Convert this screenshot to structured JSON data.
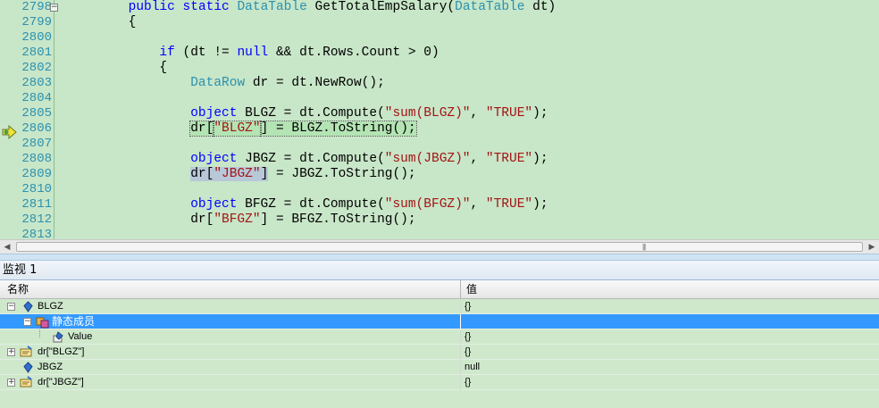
{
  "editor": {
    "line_numbers": [
      "2798",
      "2799",
      "2800",
      "2801",
      "2802",
      "2803",
      "2804",
      "2805",
      "2806",
      "2807",
      "2808",
      "2809",
      "2810",
      "2811",
      "2812",
      "2813"
    ],
    "lines": [
      [
        {
          "t": "        ",
          "c": ""
        },
        {
          "t": "public",
          "c": "kw"
        },
        {
          "t": " ",
          "c": ""
        },
        {
          "t": "static",
          "c": "kw"
        },
        {
          "t": " ",
          "c": ""
        },
        {
          "t": "DataTable",
          "c": "ty"
        },
        {
          "t": " GetTotalEmpSalary(",
          "c": ""
        },
        {
          "t": "DataTable",
          "c": "ty"
        },
        {
          "t": " dt)",
          "c": ""
        }
      ],
      [
        {
          "t": "        {",
          "c": ""
        }
      ],
      [],
      [
        {
          "t": "            ",
          "c": ""
        },
        {
          "t": "if",
          "c": "kw"
        },
        {
          "t": " (dt != ",
          "c": ""
        },
        {
          "t": "null",
          "c": "kw"
        },
        {
          "t": " && dt.Rows.Count > 0)",
          "c": ""
        }
      ],
      [
        {
          "t": "            {",
          "c": ""
        }
      ],
      [
        {
          "t": "                ",
          "c": ""
        },
        {
          "t": "DataRow",
          "c": "ty"
        },
        {
          "t": " dr = dt.NewRow();",
          "c": ""
        }
      ],
      [],
      [
        {
          "t": "                ",
          "c": ""
        },
        {
          "t": "object",
          "c": "kw"
        },
        {
          "t": " BLGZ = dt.Compute(",
          "c": ""
        },
        {
          "t": "\"sum(BLGZ)\"",
          "c": "st"
        },
        {
          "t": ", ",
          "c": ""
        },
        {
          "t": "\"TRUE\"",
          "c": "st"
        },
        {
          "t": ");",
          "c": ""
        }
      ],
      [
        {
          "t": "                ",
          "c": ""
        },
        {
          "t": "dr[",
          "c": "cur-stmt"
        },
        {
          "t": "\"BLGZ\"",
          "c": "cur-stmt st"
        },
        {
          "t": "] = BLGZ.ToString();",
          "c": "cur-stmt"
        }
      ],
      [],
      [
        {
          "t": "                ",
          "c": ""
        },
        {
          "t": "object",
          "c": "kw"
        },
        {
          "t": " JBGZ = dt.Compute(",
          "c": ""
        },
        {
          "t": "\"sum(JBGZ)\"",
          "c": "st"
        },
        {
          "t": ", ",
          "c": ""
        },
        {
          "t": "\"TRUE\"",
          "c": "st"
        },
        {
          "t": ");",
          "c": ""
        }
      ],
      [
        {
          "t": "                ",
          "c": ""
        },
        {
          "t": "dr[",
          "c": "sel-token"
        },
        {
          "t": "\"JBGZ\"",
          "c": "sel-token st"
        },
        {
          "t": "]",
          "c": "sel-token"
        },
        {
          "t": " = JBGZ.ToString();",
          "c": ""
        }
      ],
      [],
      [
        {
          "t": "                ",
          "c": ""
        },
        {
          "t": "object",
          "c": "kw"
        },
        {
          "t": " BFGZ = dt.Compute(",
          "c": ""
        },
        {
          "t": "\"sum(BFGZ)\"",
          "c": "st"
        },
        {
          "t": ", ",
          "c": ""
        },
        {
          "t": "\"TRUE\"",
          "c": "st"
        },
        {
          "t": ");",
          "c": ""
        }
      ],
      [
        {
          "t": "                dr[",
          "c": ""
        },
        {
          "t": "\"BFGZ\"",
          "c": "st"
        },
        {
          "t": "] = BFGZ.ToString();",
          "c": ""
        }
      ],
      []
    ],
    "colors": {
      "keyword": "#0000ff",
      "type": "#2b91af",
      "string": "#a31515",
      "background": "#c8e6c8"
    }
  },
  "watch": {
    "title": "监视 1",
    "col_name": "名称",
    "col_value": "值",
    "rows": [
      {
        "name": "BLGZ",
        "value": "{}",
        "icon": "field-icon"
      },
      {
        "name": "静态成员",
        "value": "",
        "icon": "static-members-icon"
      },
      {
        "name": "Value",
        "value": "{}",
        "icon": "property-icon"
      },
      {
        "name": "dr[\"BLGZ\"]",
        "value": "{}",
        "icon": "indexer-icon"
      },
      {
        "name": "JBGZ",
        "value": "null",
        "icon": "field-icon"
      },
      {
        "name": "dr[\"JBGZ\"]",
        "value": "{}",
        "icon": "indexer-icon"
      }
    ]
  }
}
